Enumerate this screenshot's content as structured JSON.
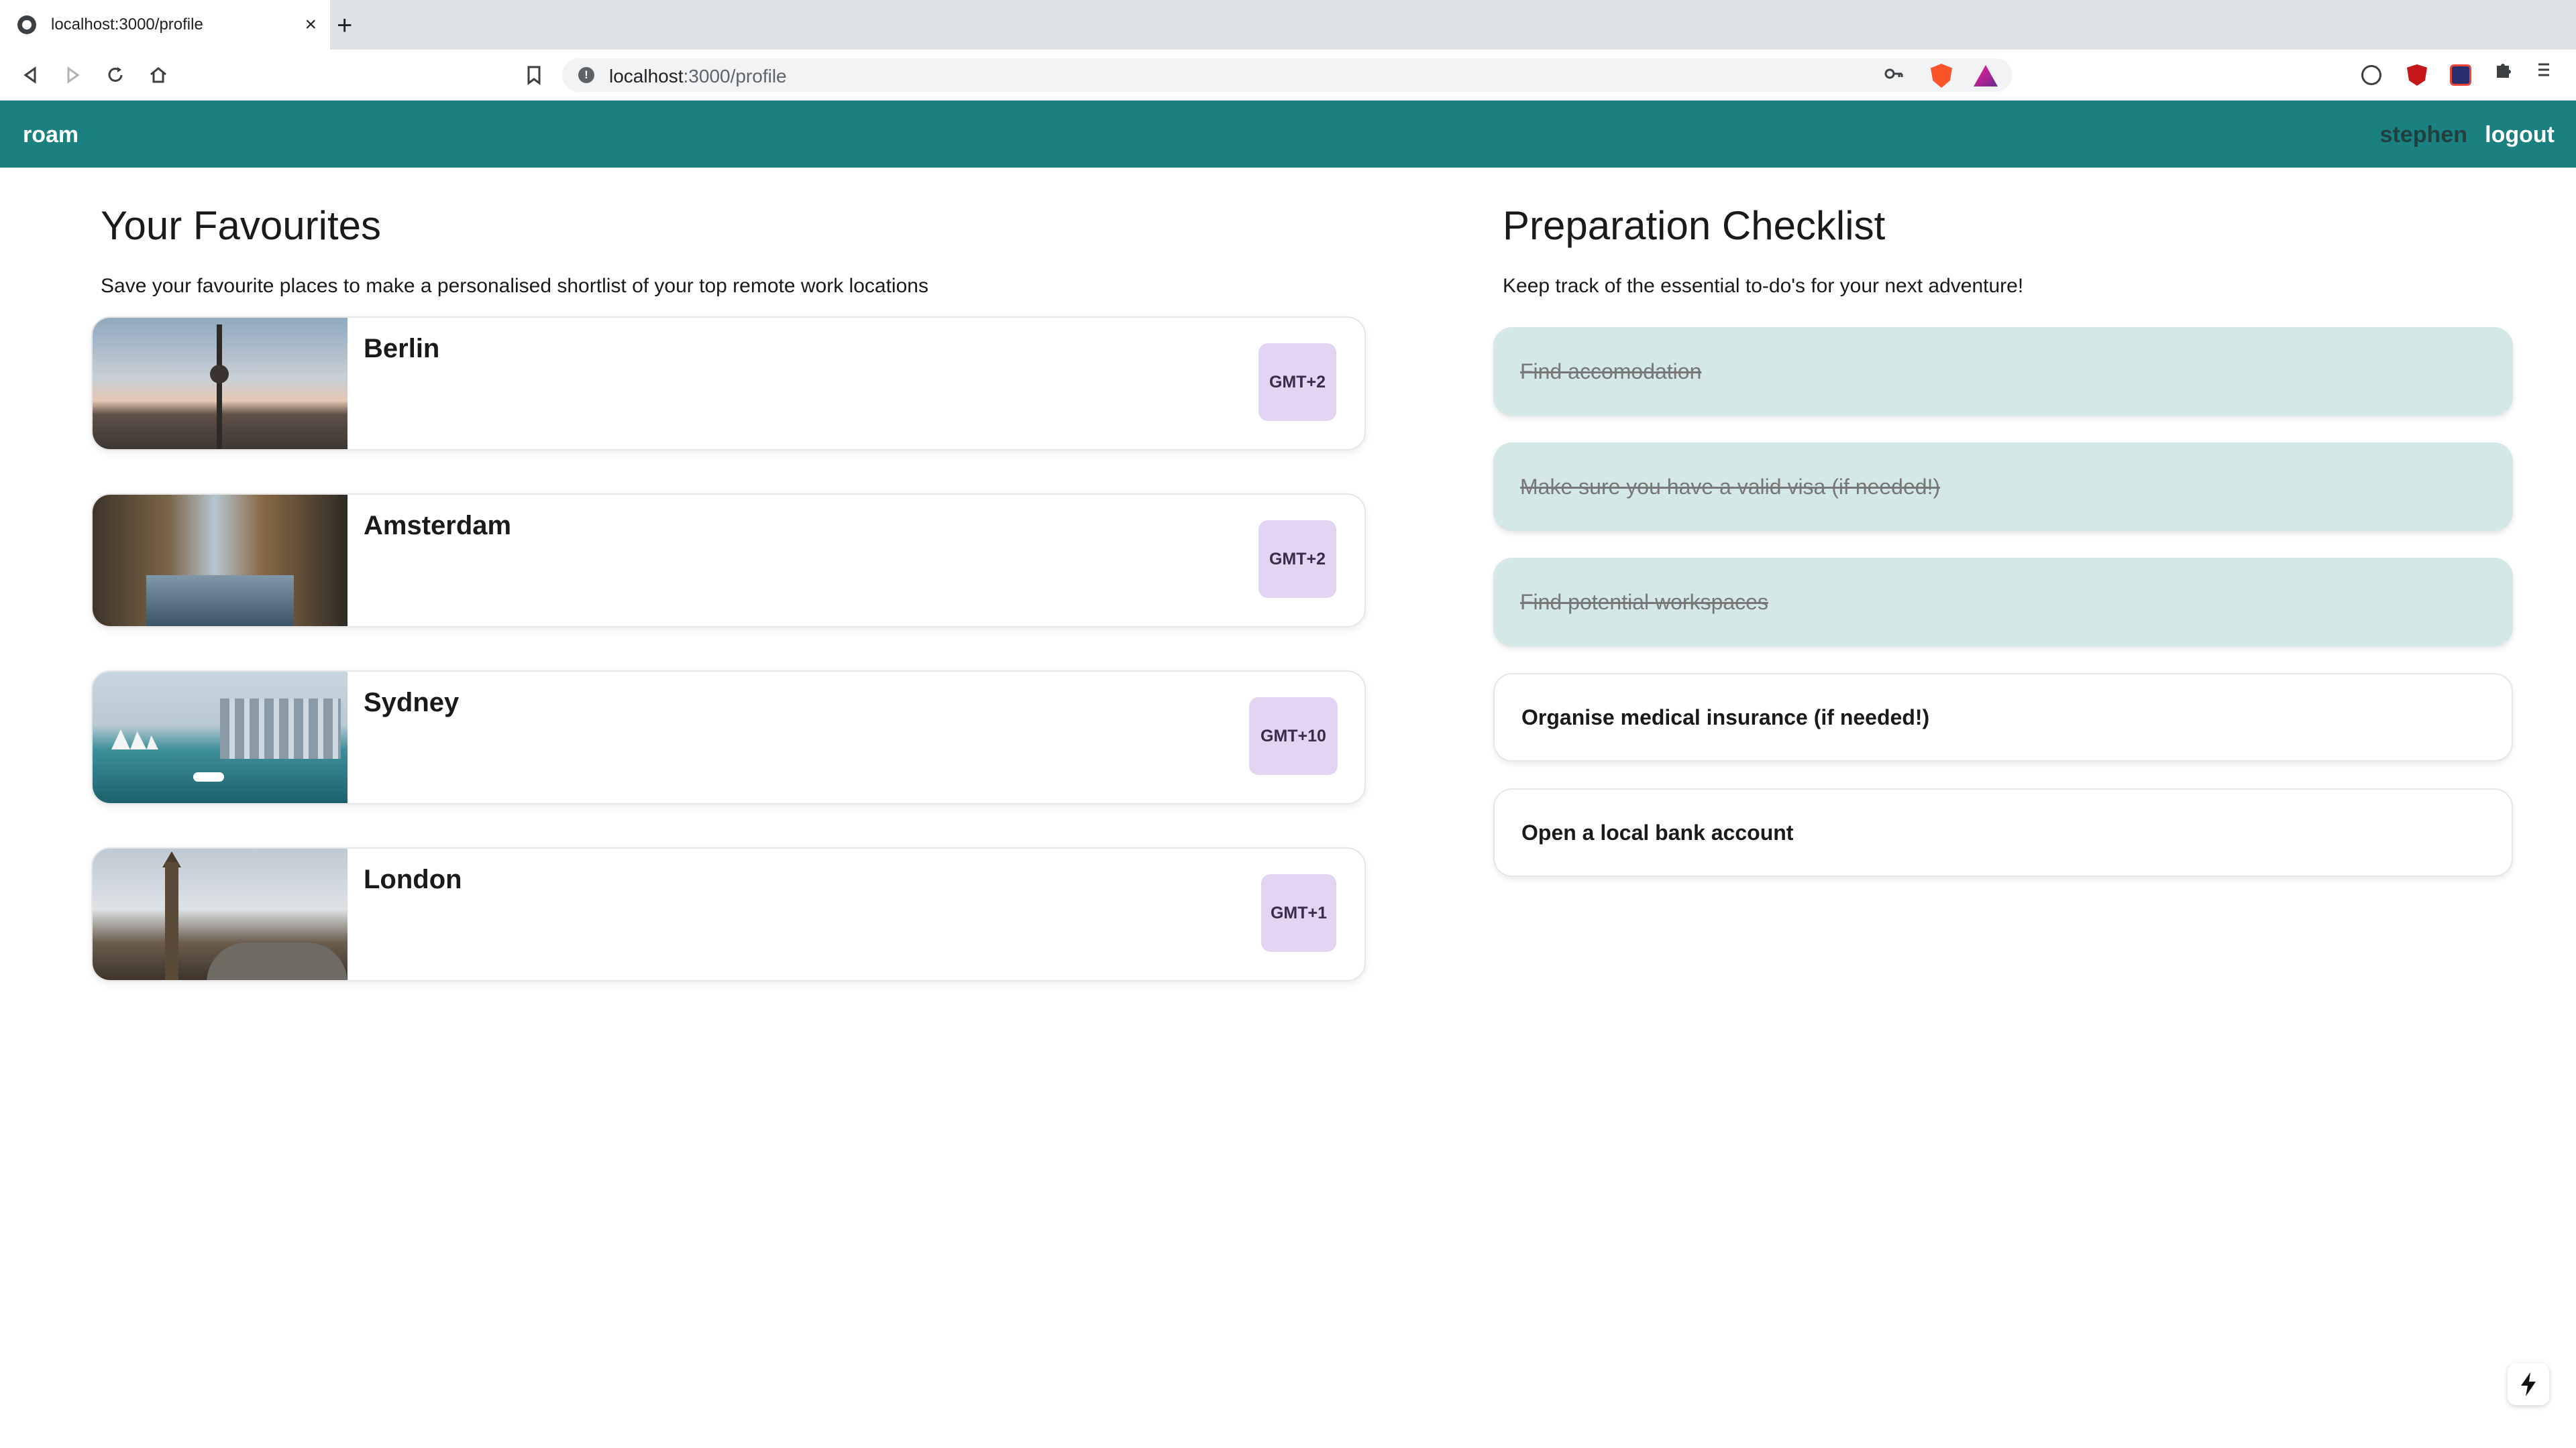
{
  "browser": {
    "tab_title": "localhost:3000/profile",
    "tab_close_glyph": "×",
    "new_tab_glyph": "+",
    "url_host": "localhost",
    "url_path": ":3000/profile",
    "icons": [
      "back-icon",
      "forward-icon",
      "reload-icon",
      "home-icon",
      "bookmark-icon",
      "info-icon",
      "key-icon",
      "brave-shields-icon",
      "brave-rewards-icon",
      "1password-icon",
      "ublock-icon",
      "extension-icon",
      "puzzle-icon",
      "menu-icon"
    ]
  },
  "header": {
    "brand": "roam",
    "user": "stephen",
    "logout": "logout",
    "bg_color": "#1b8080"
  },
  "favourites": {
    "title": "Your Favourites",
    "subtitle": "Save your favourite places to make a personalised shortlist of your top remote work locations",
    "items": [
      {
        "name": "Berlin",
        "timezone": "GMT+2"
      },
      {
        "name": "Amsterdam",
        "timezone": "GMT+2"
      },
      {
        "name": "Sydney",
        "timezone": "GMT+10"
      },
      {
        "name": "London",
        "timezone": "GMT+1"
      }
    ]
  },
  "checklist": {
    "title": "Preparation Checklist",
    "subtitle": "Keep track of the essential to-do's for your next adventure!",
    "items": [
      {
        "label": "Find accomodation",
        "done": true
      },
      {
        "label": "Make sure you have a valid visa (if needed!)",
        "done": true
      },
      {
        "label": "Find potential workspaces",
        "done": true
      },
      {
        "label": "Organise medical insurance (if needed!)",
        "done": false
      },
      {
        "label": "Open a local bank account",
        "done": false
      }
    ]
  },
  "colors": {
    "done_bg": "#d4e8e7",
    "badge_bg": "#e4d4f4"
  }
}
